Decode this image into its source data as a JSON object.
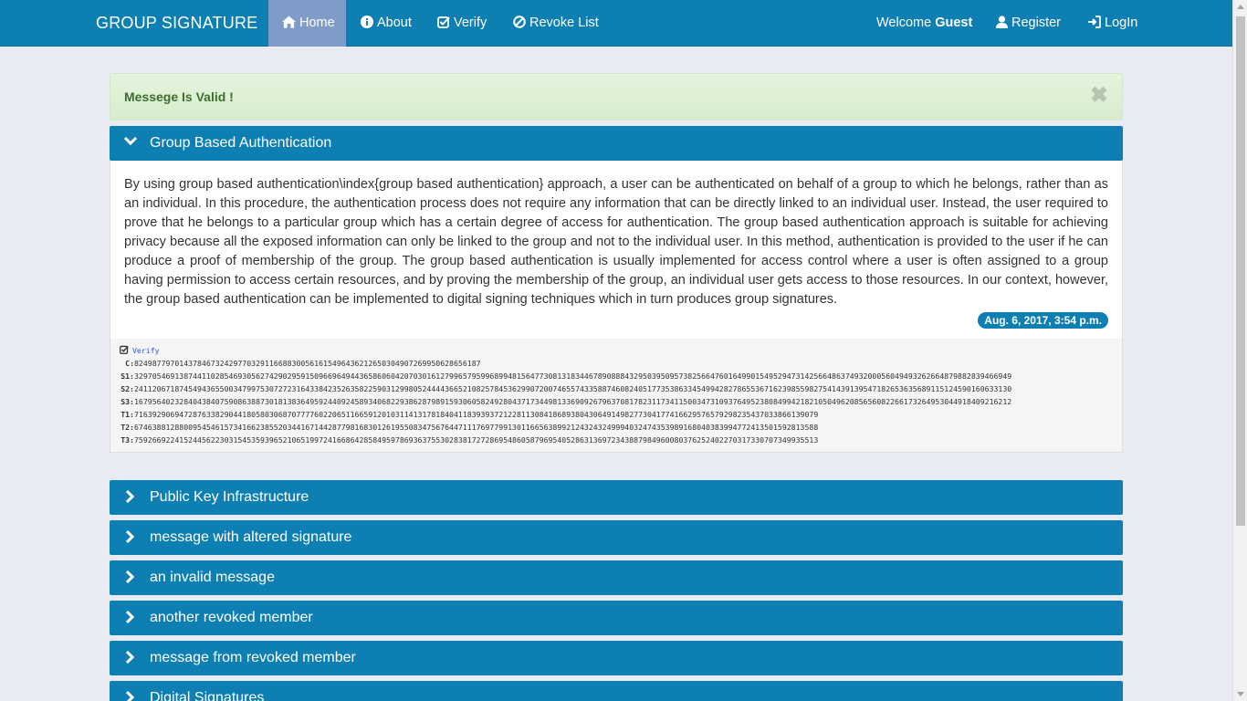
{
  "nav": {
    "brand": "GROUP SIGNATURE",
    "items": [
      {
        "label": "Home",
        "icon": "home-icon"
      },
      {
        "label": "About",
        "icon": "info-icon"
      },
      {
        "label": "Verify",
        "icon": "check-square-icon"
      },
      {
        "label": "Revoke List",
        "icon": "ban-icon"
      }
    ],
    "welcome_prefix": "Welcome",
    "welcome_user": "Guest",
    "register": "Register",
    "login": "LogIn"
  },
  "alert": {
    "message": "Messege Is Valid !",
    "close": "✖"
  },
  "panels": [
    {
      "title": "Group Based Authentication",
      "expanded": true,
      "body": "By using group based authentication\\index{group based authentication} approach, a user can be authenticated on behalf of a group to which he belongs, rather than as an individual. In this procedure, the authentication process does not require any information that can be directly linked to an individual user. Instead, the user required to prove that he belongs to a particular group which has a certain degree of access for authentication. The group based authentication approach is suitable for achieving privacy because all the exposed information can only be linked to the group and not to the individual user. In this method, authentication is provided to the user if he can produce a proof of membership of the group. The group based authentication is usually implemented for access control where a user is often assigned to a group having permission to access certain resources, and by proving the membership of the group, an individual user gets access to those resources. In our context, however, the group based authentication can be implemented to digital signing techniques which in turn produces group signatures.",
      "date": "Aug. 6, 2017, 3:54 p.m.",
      "verify_label": "Verify",
      "signature": [
        {
          "key": "C:",
          "value": "82498779701437846732429770329116688300561615496436212650304907269950628656187"
        },
        {
          "key": "S1:",
          "value": "329705469138744110285469305627429029591509669649443658606042070301612799657959968994815647730813183446789088843295039509573825664760164990154952947314256648637493200056049493262664879882839466949"
        },
        {
          "key": "S2:",
          "value": "241120671874549436550034799753072723164338423526358225903129980524444366521082578453629907200746557433588746082405177353863345499428278655367162398559827541439139547182653635689115124590160633130"
        },
        {
          "key": "S3:",
          "value": "167956402328404384075908638873018138364959244092458934068229386287989159306058249280437173449813369092679637081782311734115003473109376495238084994218210504962085656082266173264953044918409216212"
        },
        {
          "key": "T1:",
          "value": "71639290694728763382904418058030687077776022065116659120103114131781840411839393721228113084186893804306491498277304177416629576579298235437033866139079"
        },
        {
          "key": "T2:",
          "value": "67463881288009545461573416623855203441671442877981683012619550834756764471117697799130116656389921243243249994032474353989168040383994772413501592813588"
        },
        {
          "key": "T3:",
          "value": "75926692241524456223031545359396521065199724166864285849597869363755302838172728695486058796954052863136972343887984960080376252402270317330707349935513"
        }
      ]
    },
    {
      "title": "Public Key Infrastructure",
      "expanded": false
    },
    {
      "title": "message with altered signature",
      "expanded": false
    },
    {
      "title": "an invalid message",
      "expanded": false
    },
    {
      "title": "another revoked member",
      "expanded": false
    },
    {
      "title": "message from revoked member",
      "expanded": false
    },
    {
      "title": "Digital Signatures",
      "expanded": false
    }
  ],
  "colors": {
    "primary": "#0e7fb3",
    "active_nav": "#7f9cc9",
    "alert_bg": "#dff0d8",
    "alert_text": "#3c6e2e",
    "page_bg": "#e9ebf3"
  }
}
